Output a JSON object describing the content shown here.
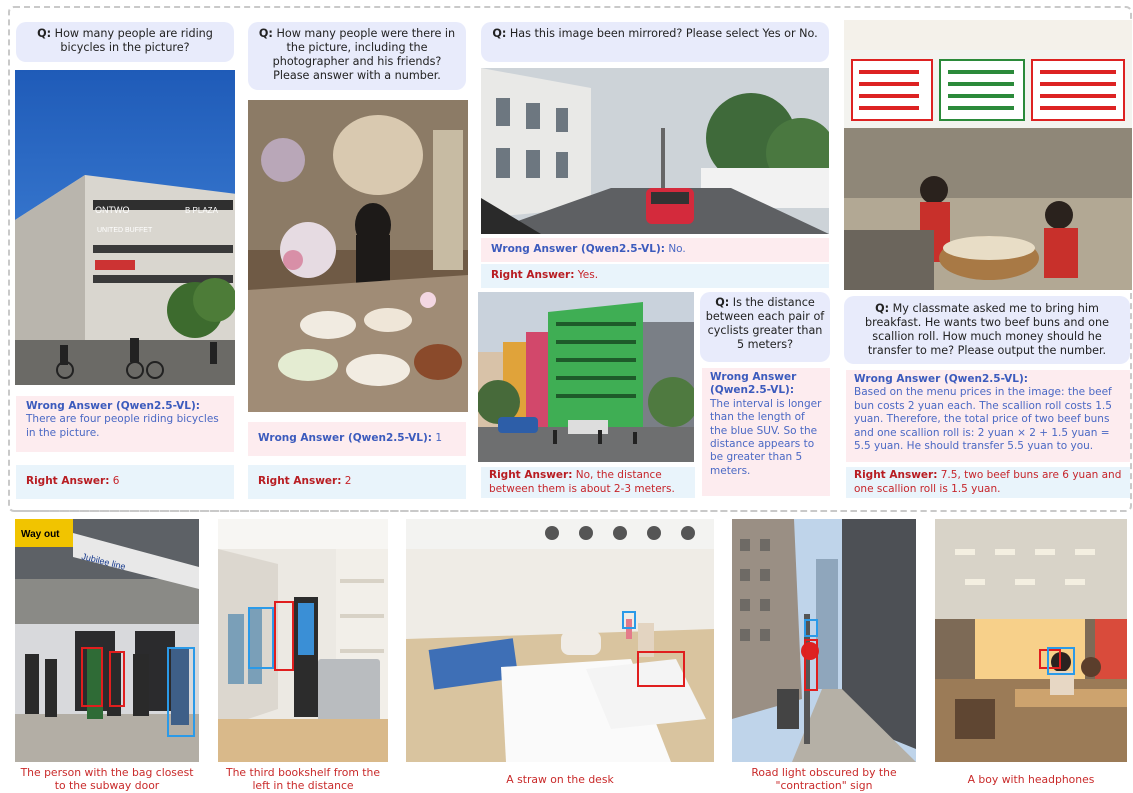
{
  "panels": [
    {
      "question": "How many people are riding bicycles in the picture?",
      "wrong_label": "Wrong Answer (Qwen2.5-VL):",
      "wrong_text": "There are four people riding bicycles in the picture.",
      "right_label": "Right Answer:",
      "right_text": "6"
    },
    {
      "question": "How many people were there in the picture, including the photographer and his friends? Please answer with a number.",
      "wrong_label": "Wrong Answer (Qwen2.5-VL):",
      "wrong_text": "1",
      "right_label": "Right Answer:",
      "right_text": "2"
    },
    {
      "question": "Has this image been mirrored? Please select Yes or No.",
      "wrong_label": "Wrong Answer (Qwen2.5-VL):",
      "wrong_text": "No.",
      "right_label": "Right Answer:",
      "right_text": "Yes."
    },
    {
      "question": "Is the distance between each pair of cyclists greater than 5 meters?",
      "wrong_label": "Wrong Answer (Qwen2.5-VL):",
      "wrong_text": "The interval is longer than the length of the blue SUV. So the distance appears to be greater than 5 meters.",
      "right_label": "Right Answer:",
      "right_text": "No, the distance between them is about 2-3 meters."
    },
    {
      "question": "My classmate asked me to bring him breakfast. He wants two beef buns and one scallion roll. How much money should he transfer to me? Please output the number.",
      "wrong_label": "Wrong Answer (Qwen2.5-VL):",
      "wrong_text": "Based on the menu prices in the image: the beef bun costs 2 yuan each. The scallion roll costs 1.5 yuan. Therefore, the total price of two beef buns and one scallion roll is: 2 yuan × 2 + 1.5 yuan = 5.5 yuan. He should transfer 5.5 yuan to you.",
      "right_label": "Right Answer:",
      "right_text": "7.5, two beef buns are 6 yuan and one scallion roll is 1.5 yuan."
    }
  ],
  "q_prefix": "Q:",
  "signs": {
    "building_brand": "ONTWO",
    "building_plaza": "B PLAZA",
    "building_buffet": "UNITED BUFFET",
    "subway_wayout": "Way out",
    "subway_line": "Jubilee line"
  },
  "captions": [
    "The person with the bag closest to the subway door",
    "The third bookshelf from the left in the distance",
    "A straw on the desk",
    "Road light obscured by the \"contraction\" sign",
    "A boy with headphones"
  ]
}
